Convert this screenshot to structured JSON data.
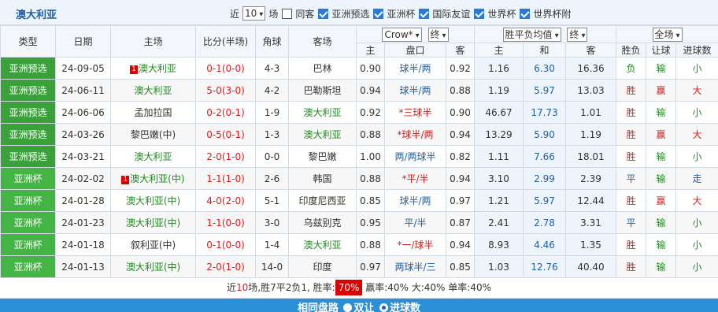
{
  "header": {
    "team": "澳大利亚",
    "near_label": "近",
    "count_value": "10",
    "match_label": "场",
    "same_host_label": "同客",
    "filters": [
      "亚洲预选",
      "亚洲杯",
      "国际友谊",
      "世界杯",
      "世界杯附"
    ]
  },
  "columns": {
    "type": "类型",
    "date": "日期",
    "home": "主场",
    "score": "比分(半场)",
    "corners": "角球",
    "away": "客场",
    "company": "Crow*",
    "term1": "终",
    "odds_type": "胜平负均值",
    "term2": "终",
    "scope": "全场",
    "sub_asian": [
      "主",
      "盘口",
      "客"
    ],
    "sub_euro": [
      "主",
      "和",
      "客"
    ],
    "sub_result": [
      "胜负",
      "让球",
      "进球数"
    ]
  },
  "rows": [
    {
      "type": "亚洲预选",
      "date": "24-09-05",
      "badge": "1",
      "home": "澳大利亚",
      "score": "0-1(0-0)",
      "corners": "4-3",
      "away": "巴林",
      "h": "0.90",
      "line": "球半/两",
      "a": "0.92",
      "e1": "1.16",
      "e2": "6.30",
      "e3": "16.36",
      "r1": "负",
      "r2": "输",
      "r3": "小"
    },
    {
      "type": "亚洲预选",
      "date": "24-06-11",
      "badge": "",
      "home": "澳大利亚",
      "score": "5-0(3-0)",
      "corners": "4-2",
      "away": "巴勒斯坦",
      "h": "0.94",
      "line": "球半/两",
      "a": "0.88",
      "e1": "1.19",
      "e2": "5.97",
      "e3": "13.03",
      "r1": "胜",
      "r2": "赢",
      "r3": "大"
    },
    {
      "type": "亚洲预选",
      "date": "24-06-06",
      "badge": "",
      "home": "孟加拉国",
      "score": "0-2(0-1)",
      "corners": "1-9",
      "away": "澳大利亚",
      "h": "0.92",
      "line": "*三球半",
      "a": "0.90",
      "e1": "46.67",
      "e2": "17.73",
      "e3": "1.01",
      "r1": "胜",
      "r2": "输",
      "r3": "小"
    },
    {
      "type": "亚洲预选",
      "date": "24-03-26",
      "badge": "",
      "home": "黎巴嫩(中)",
      "score": "0-5(0-1)",
      "corners": "1-3",
      "away": "澳大利亚",
      "h": "0.88",
      "line": "*球半/两",
      "a": "0.94",
      "e1": "13.29",
      "e2": "5.90",
      "e3": "1.19",
      "r1": "胜",
      "r2": "赢",
      "r3": "大"
    },
    {
      "type": "亚洲预选",
      "date": "24-03-21",
      "badge": "",
      "home": "澳大利亚",
      "score": "2-0(1-0)",
      "corners": "0-0",
      "away": "黎巴嫩",
      "h": "1.00",
      "line": "两/两球半",
      "a": "0.82",
      "e1": "1.11",
      "e2": "7.66",
      "e3": "18.01",
      "r1": "胜",
      "r2": "输",
      "r3": "小"
    },
    {
      "type": "亚洲杯",
      "date": "24-02-02",
      "badge": "1",
      "home": "澳大利亚(中)",
      "score": "1-1(1-0)",
      "corners": "2-6",
      "away": "韩国",
      "h": "0.88",
      "line": "*平/半",
      "a": "0.94",
      "e1": "3.10",
      "e2": "2.99",
      "e3": "2.39",
      "r1": "平",
      "r2": "输",
      "r3": "走"
    },
    {
      "type": "亚洲杯",
      "date": "24-01-28",
      "badge": "",
      "home": "澳大利亚(中)",
      "score": "4-0(2-0)",
      "corners": "5-1",
      "away": "印度尼西亚",
      "h": "0.85",
      "line": "球半/两",
      "a": "0.97",
      "e1": "1.21",
      "e2": "5.97",
      "e3": "12.44",
      "r1": "胜",
      "r2": "赢",
      "r3": "大"
    },
    {
      "type": "亚洲杯",
      "date": "24-01-23",
      "badge": "",
      "home": "澳大利亚(中)",
      "score": "1-1(0-0)",
      "corners": "3-0",
      "away": "乌兹别克",
      "h": "0.95",
      "line": "平/半",
      "a": "0.87",
      "e1": "2.41",
      "e2": "2.78",
      "e3": "3.31",
      "r1": "平",
      "r2": "输",
      "r3": "小"
    },
    {
      "type": "亚洲杯",
      "date": "24-01-18",
      "badge": "",
      "home": "叙利亚(中)",
      "score": "0-1(0-0)",
      "corners": "1-4",
      "away": "澳大利亚",
      "h": "0.88",
      "line": "*一/球半",
      "a": "0.94",
      "e1": "8.93",
      "e2": "4.46",
      "e3": "1.35",
      "r1": "胜",
      "r2": "输",
      "r3": "小"
    },
    {
      "type": "亚洲杯",
      "date": "24-01-13",
      "badge": "",
      "home": "澳大利亚(中)",
      "score": "2-0(1-0)",
      "corners": "14-0",
      "away": "印度",
      "h": "0.97",
      "line": "两球半/三",
      "a": "0.85",
      "e1": "1.03",
      "e2": "12.76",
      "e3": "40.40",
      "r1": "胜",
      "r2": "输",
      "r3": "小"
    }
  ],
  "summary": {
    "prefix": "近",
    "count": "10",
    "middle": "场,胜7平2负1, 胜率:",
    "win_rate": "70%",
    "rest": "赢率:40% 大:40% 单率:40%"
  },
  "footer": {
    "title": "相同盘路",
    "opt1": "双让",
    "opt2": "进球数"
  },
  "colors": {
    "team": "#1d8b1d",
    "red": "#d91d1d",
    "blue": "#1f5fa8",
    "type_bg": "#3aa03a",
    "footer_bg": "#2b8fd6"
  }
}
